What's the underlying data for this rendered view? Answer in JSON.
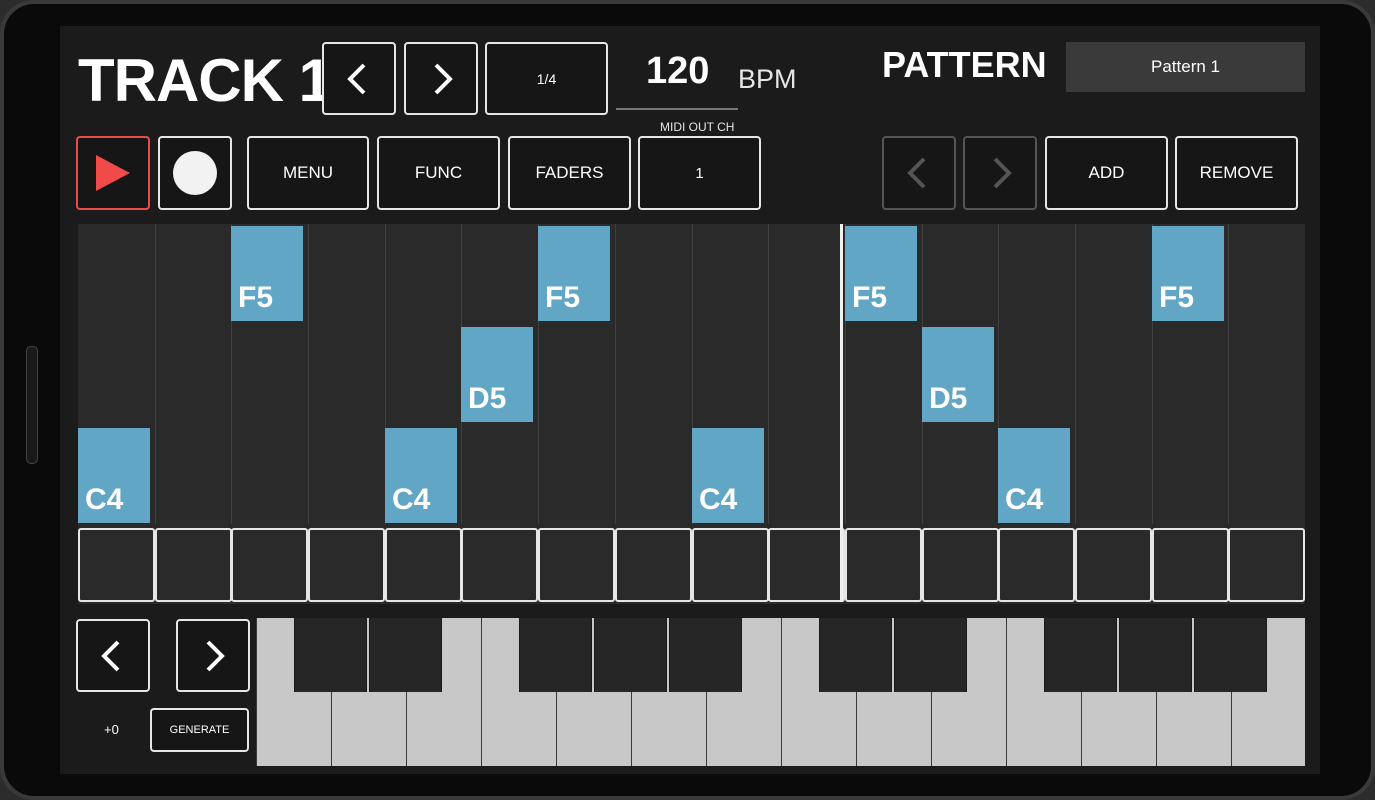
{
  "header": {
    "track_title": "TRACK 1",
    "division": "1/4",
    "bpm_value": "120",
    "bpm_label": "BPM",
    "midi_label": "MIDI OUT CH",
    "pattern_label": "PATTERN",
    "pattern_name": "Pattern 1"
  },
  "toolbar": {
    "menu": "MENU",
    "func": "FUNC",
    "faders": "FADERS",
    "midi_channel": "1",
    "add": "ADD",
    "remove": "REMOVE"
  },
  "sequencer": {
    "steps": 16,
    "notes": [
      {
        "step": 0,
        "label": "C4"
      },
      {
        "step": 2,
        "label": "F5"
      },
      {
        "step": 4,
        "label": "C4"
      },
      {
        "step": 5,
        "label": "D5"
      },
      {
        "step": 6,
        "label": "F5"
      },
      {
        "step": 8,
        "label": "C4"
      },
      {
        "step": 10,
        "label": "F5"
      },
      {
        "step": 11,
        "label": "D5"
      },
      {
        "step": 12,
        "label": "C4"
      },
      {
        "step": 14,
        "label": "F5"
      }
    ]
  },
  "keyboard": {
    "octave_offset": "+0",
    "generate": "GENERATE"
  },
  "colors": {
    "note": "#61a6c4",
    "play_border": "#e84b4b",
    "play_triangle": "#f04a4a"
  }
}
